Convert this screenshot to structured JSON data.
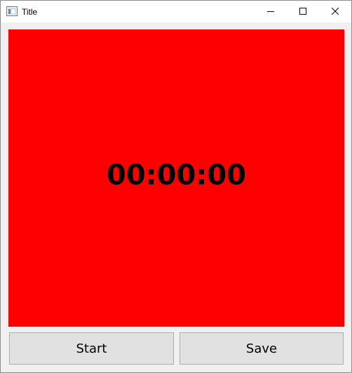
{
  "window": {
    "title": "Title"
  },
  "display": {
    "time": "00:00:00",
    "background_color": "#ff0000"
  },
  "buttons": {
    "start_label": "Start",
    "save_label": "Save"
  },
  "icons": {
    "app": "window-app-icon",
    "minimize": "minimize-icon",
    "maximize": "maximize-icon",
    "close": "close-icon"
  }
}
